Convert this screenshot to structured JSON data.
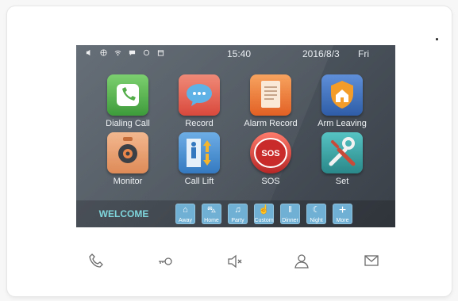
{
  "status": {
    "time": "15:40",
    "date": "2016/8/3",
    "day": "Fri",
    "icons": [
      "speaker-icon",
      "network-icon",
      "wifi-icon",
      "message-icon",
      "record-icon",
      "calendar-icon"
    ]
  },
  "tiles": [
    {
      "label": "Dialing Call",
      "icon": "phone-icon",
      "color": "#59b84f"
    },
    {
      "label": "Record",
      "icon": "chat-bubble-icon",
      "color": "#e66b5c"
    },
    {
      "label": "Alarm Record",
      "icon": "document-icon",
      "color": "#ef7b39"
    },
    {
      "label": "Arm Leaving",
      "icon": "house-shield-icon",
      "color": "#4a78c3"
    },
    {
      "label": "Monitor",
      "icon": "camera-icon",
      "color": "#e7a074"
    },
    {
      "label": "Call Lift",
      "icon": "elevator-icon",
      "color": "#4d8fd0"
    },
    {
      "label": "SOS",
      "icon": "sos-icon",
      "color": "#e24545"
    },
    {
      "label": "Set",
      "icon": "tools-icon",
      "color": "#3fa6a8"
    }
  ],
  "welcome": "WELCOME",
  "modes": [
    {
      "label": "Away",
      "icon": "away-icon"
    },
    {
      "label": "Home",
      "icon": "car-icon"
    },
    {
      "label": "Party",
      "icon": "party-icon"
    },
    {
      "label": "Custom",
      "icon": "custom-icon"
    },
    {
      "label": "Dinner",
      "icon": "dinner-icon"
    },
    {
      "label": "Night",
      "icon": "moon-icon"
    },
    {
      "label": "More",
      "icon": "plus-icon"
    }
  ],
  "hardkeys": [
    "phone-key-icon",
    "key-icon",
    "mute-icon",
    "user-icon",
    "mail-icon"
  ]
}
